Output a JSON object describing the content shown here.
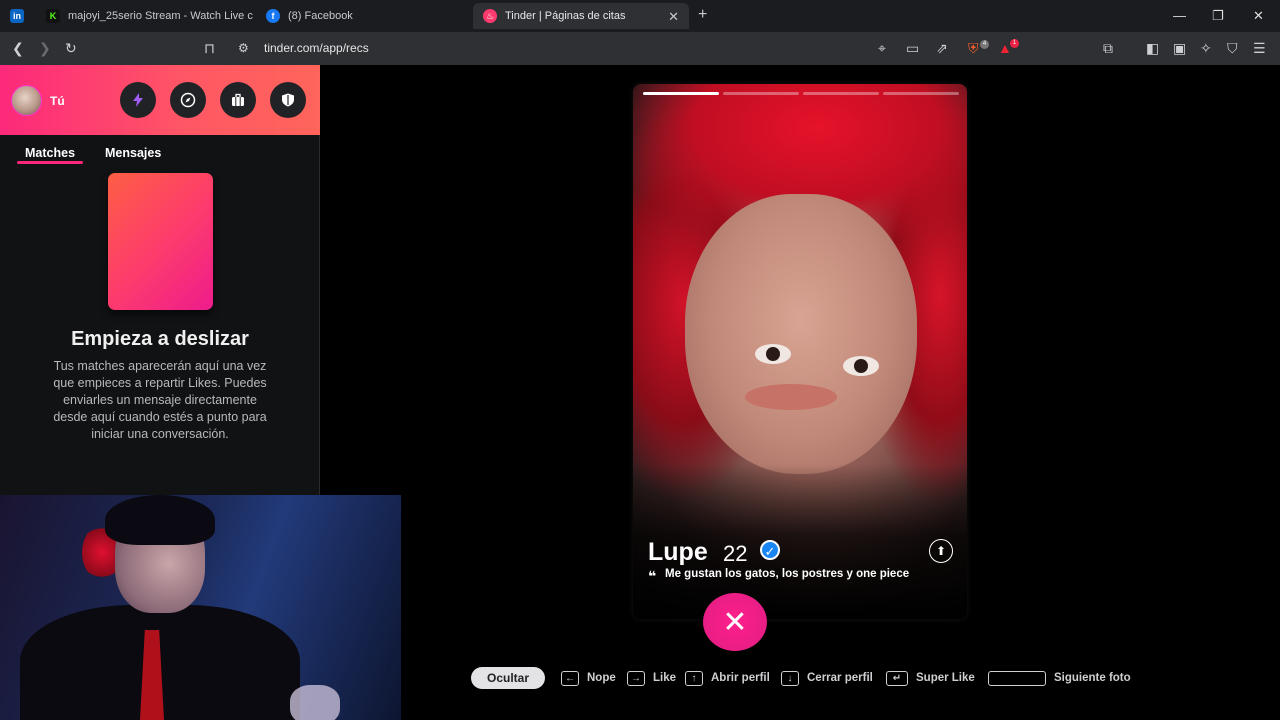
{
  "browser": {
    "tabs": [
      {
        "title": "",
        "icon": "linkedin-icon"
      },
      {
        "title": "majoyi_25serio Stream - Watch Live c",
        "icon": "kick-icon"
      },
      {
        "title": "(8) Facebook",
        "icon": "facebook-icon"
      },
      {
        "title": "Tinder | Páginas de citas",
        "icon": "tinder-icon",
        "active": true
      }
    ],
    "url": "tinder.com/app/recs",
    "brave_badge": "4",
    "rewards_badge": "1"
  },
  "sidebar": {
    "user_label": "Tú",
    "tabs": [
      "Matches",
      "Mensajes"
    ],
    "active_tab": "Matches",
    "empty_title": "Empieza a deslizar",
    "empty_body": "Tus matches aparecerán aquí una vez que empieces a repartir Likes. Puedes enviarles un mensaje directamente desde aquí cuando estés a punto para iniciar una conversación."
  },
  "profile": {
    "name": "Lupe",
    "age": "22",
    "bio": "Me gustan los gatos, los postres y one piece",
    "photo_count": 4,
    "current_photo": 1,
    "verified": true
  },
  "actions": {
    "nope_symbol": "✕"
  },
  "shortcuts": {
    "hide": "Ocultar",
    "nope": "Nope",
    "like": "Like",
    "open_profile": "Abrir perfil",
    "close_profile": "Cerrar perfil",
    "super_like": "Super Like",
    "next_photo": "Siguiente foto"
  },
  "colors": {
    "brand_gradient_start": "#fd297b",
    "brand_gradient_end": "#ff655b",
    "nope": "#e91e86"
  }
}
